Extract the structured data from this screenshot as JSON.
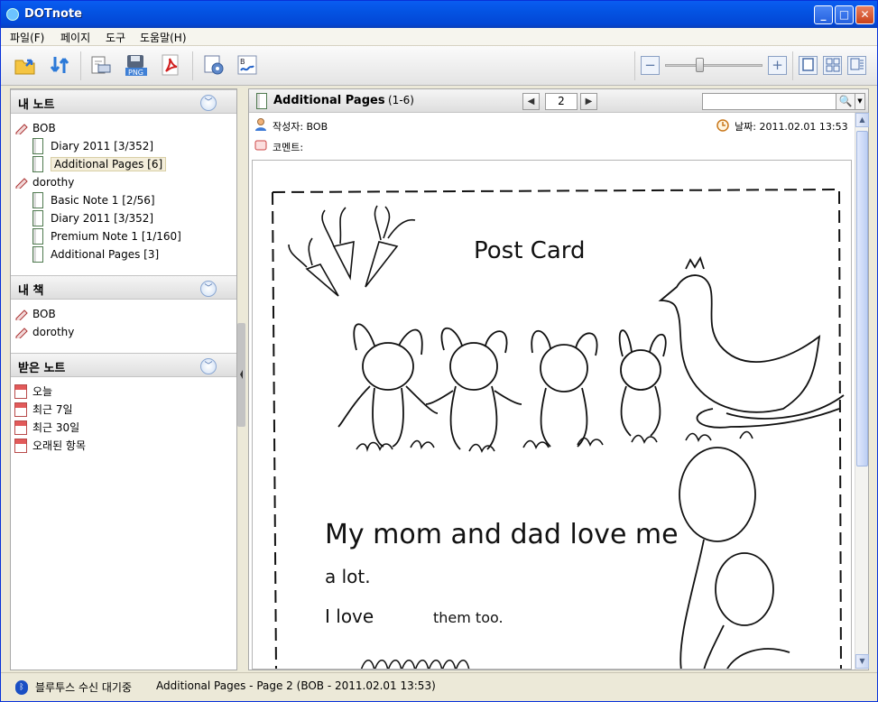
{
  "window": {
    "title": "DOTnote"
  },
  "menu": [
    "파일(F)",
    "페이지",
    "도구",
    "도움말(H)"
  ],
  "toolbar": {
    "icons": [
      "open-folder-icon",
      "sync-icon",
      "print-setup-icon",
      "save-png-icon",
      "export-pdf-icon",
      "page-settings-icon",
      "signature-icon"
    ],
    "png_label": "PNG",
    "zoom_minus": "−",
    "zoom_plus": "+",
    "zoom_level": 0.4
  },
  "sidebar": {
    "my_notes": {
      "title": "내 노트",
      "owners": [
        {
          "name": "BOB",
          "notes": [
            "Diary 2011 [3/352]",
            "Additional Pages [6]"
          ]
        },
        {
          "name": "dorothy",
          "notes": [
            "Basic Note 1 [2/56]",
            "Diary 2011 [3/352]",
            "Premium Note 1 [1/160]",
            "Additional Pages [3]"
          ]
        }
      ]
    },
    "my_books": {
      "title": "내 책",
      "items": [
        "BOB",
        "dorothy"
      ]
    },
    "received": {
      "title": "받은 노트",
      "items": [
        "오늘",
        "최근 7일",
        "최근 30일",
        "오래된 항목"
      ]
    }
  },
  "main": {
    "title": "Additional Pages",
    "range": "(1-6)",
    "page": "2",
    "search_placeholder": "",
    "author_label": "작성자: BOB",
    "date_label": "날짜: 2011.02.01 13:53",
    "comment_label": "코멘트:"
  },
  "handwriting": {
    "heading": "Post Card",
    "line1": "My mom and dad love me",
    "line2": "a lot.",
    "line3a": "I love",
    "line3b": "them too."
  },
  "status": {
    "bluetooth": "블루투스 수신 대기중",
    "page_info": "Additional Pages - Page 2 (BOB - 2011.02.01 13:53)"
  },
  "colors": {
    "title_bar": "#0453e2",
    "accent": "#3c64a5",
    "selection": "#f4eedb"
  }
}
